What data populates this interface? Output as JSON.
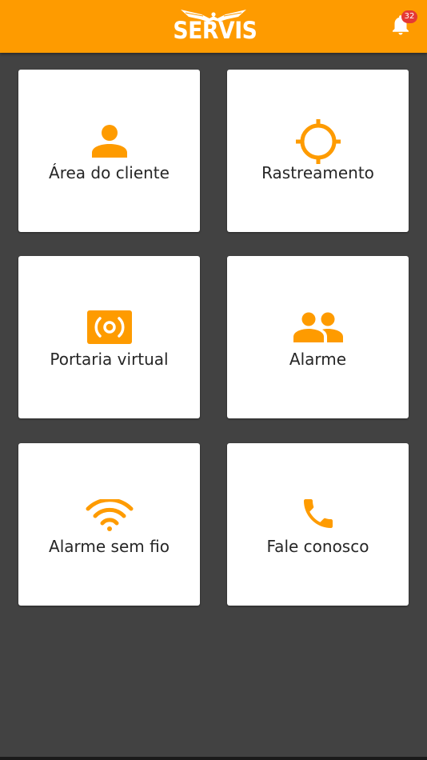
{
  "header": {
    "logo_text": "SERVIS",
    "notification_count": "32"
  },
  "menu": {
    "items": [
      {
        "label": "Área do cliente",
        "icon": "person-icon"
      },
      {
        "label": "Rastreamento",
        "icon": "crosshair-icon"
      },
      {
        "label": "Portaria virtual",
        "icon": "intercom-icon"
      },
      {
        "label": "Alarme",
        "icon": "people-icon"
      },
      {
        "label": "Alarme sem fio",
        "icon": "wifi-icon"
      },
      {
        "label": "Fale conosco",
        "icon": "phone-icon"
      }
    ]
  },
  "colors": {
    "accent": "#fe9b00",
    "background": "#424242",
    "card": "#ffffff",
    "text": "#262626",
    "badge": "#e53935"
  }
}
